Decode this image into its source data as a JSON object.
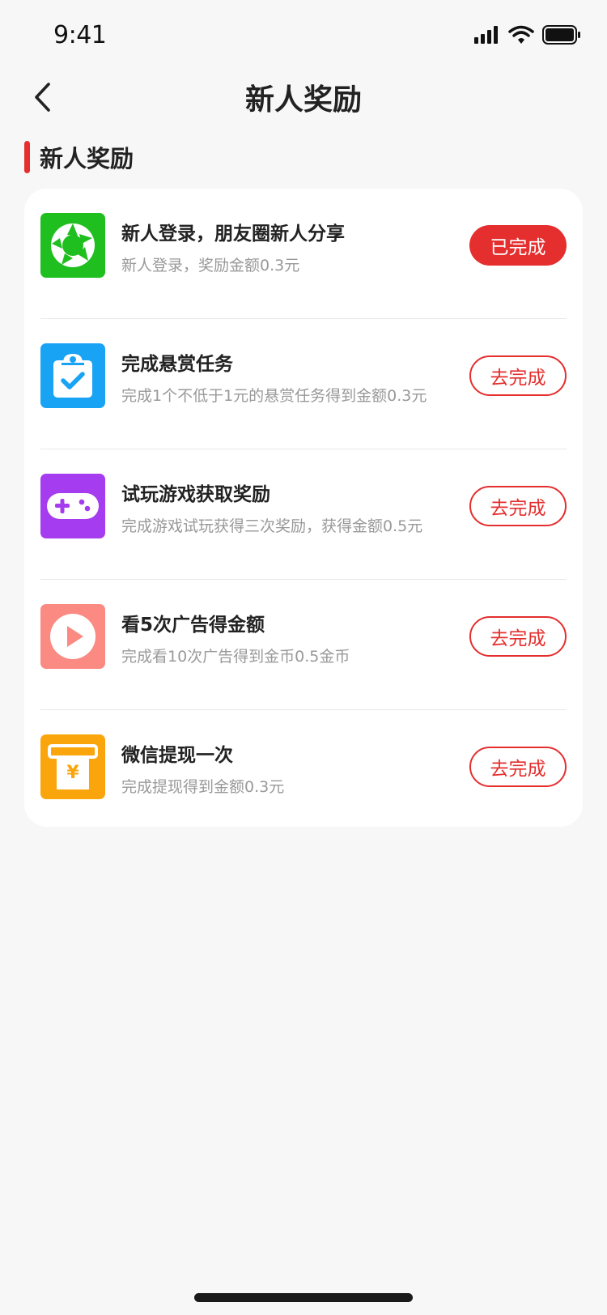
{
  "status_bar": {
    "time": "9:41"
  },
  "nav": {
    "title": "新人奖励"
  },
  "section": {
    "title": "新人奖励"
  },
  "colors": {
    "accent": "#e52e2e",
    "background": "#f7f7f7"
  },
  "tasks": [
    {
      "title": "新人登录，朋友圈新人分享",
      "desc": "新人登录，奖励金额0.3元",
      "button": "已完成",
      "done": true,
      "icon": "camera-aperture-icon",
      "icon_color": "#1fbf1f"
    },
    {
      "title": "完成悬赏任务",
      "desc": "完成1个不低于1元的悬赏任务得到金额0.3元",
      "button": "去完成",
      "done": false,
      "icon": "clipboard-check-icon",
      "icon_color": "#18a3f5"
    },
    {
      "title": "试玩游戏获取奖励",
      "desc": "完成游戏试玩获得三次奖励，获得金额0.5元",
      "button": "去完成",
      "done": false,
      "icon": "gamepad-icon",
      "icon_color": "#a53cf0"
    },
    {
      "title": "看5次广告得金额",
      "desc": "完成看10次广告得到金币0.5金币",
      "button": "去完成",
      "done": false,
      "icon": "play-icon",
      "icon_color": "#fa8a82"
    },
    {
      "title": "微信提现一次",
      "desc": "完成提现得到金额0.3元",
      "button": "去完成",
      "done": false,
      "icon": "withdraw-yen-icon",
      "icon_color": "#fba50c"
    }
  ]
}
